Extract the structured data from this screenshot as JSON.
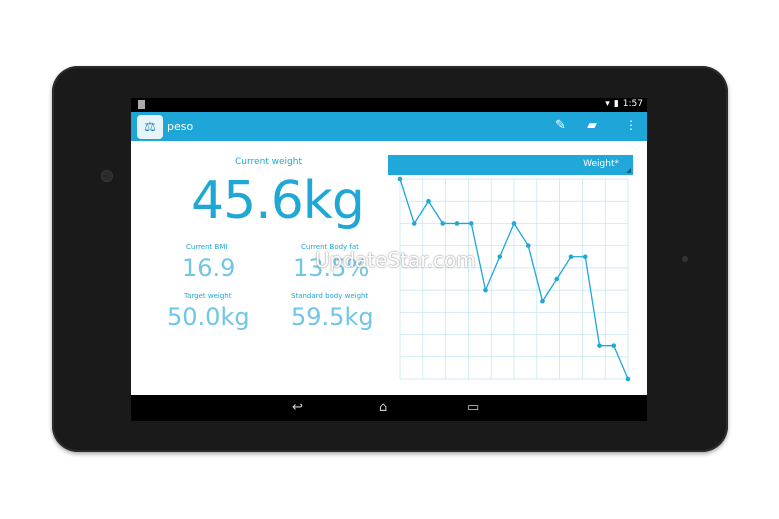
{
  "statusbar": {
    "time": "1:57",
    "wifi_icon": "wifi-icon",
    "battery_icon": "battery-icon"
  },
  "actionbar": {
    "app_name": "peso",
    "edit_icon": "pencil-icon",
    "folder_icon": "folder-icon",
    "overflow_icon": "overflow-menu-icon"
  },
  "summary": {
    "current_weight_label": "Current weight",
    "current_weight_value": "45.6kg",
    "bmi_label": "Current BMI",
    "bmi_value": "16.9",
    "body_fat_label": "Current Body fat",
    "body_fat_value": "13.5%",
    "target_label": "Target weight",
    "target_value": "50.0kg",
    "standard_label": "Standard body weight",
    "standard_value": "59.5kg"
  },
  "chart_header": {
    "title": "Weight*"
  },
  "chart_data": {
    "type": "line",
    "ylim": [
      0,
      9
    ],
    "grid": true,
    "values": [
      9,
      7,
      8,
      7,
      7,
      7,
      4,
      5.5,
      7,
      6,
      3.5,
      4.5,
      5.5,
      5.5,
      1.5,
      1.5,
      0
    ],
    "series_color": "#1fa7d6"
  },
  "navbar": {
    "back_icon": "back-icon",
    "home_icon": "home-icon",
    "recents_icon": "recents-icon"
  },
  "watermark": "UpdateStar.com"
}
